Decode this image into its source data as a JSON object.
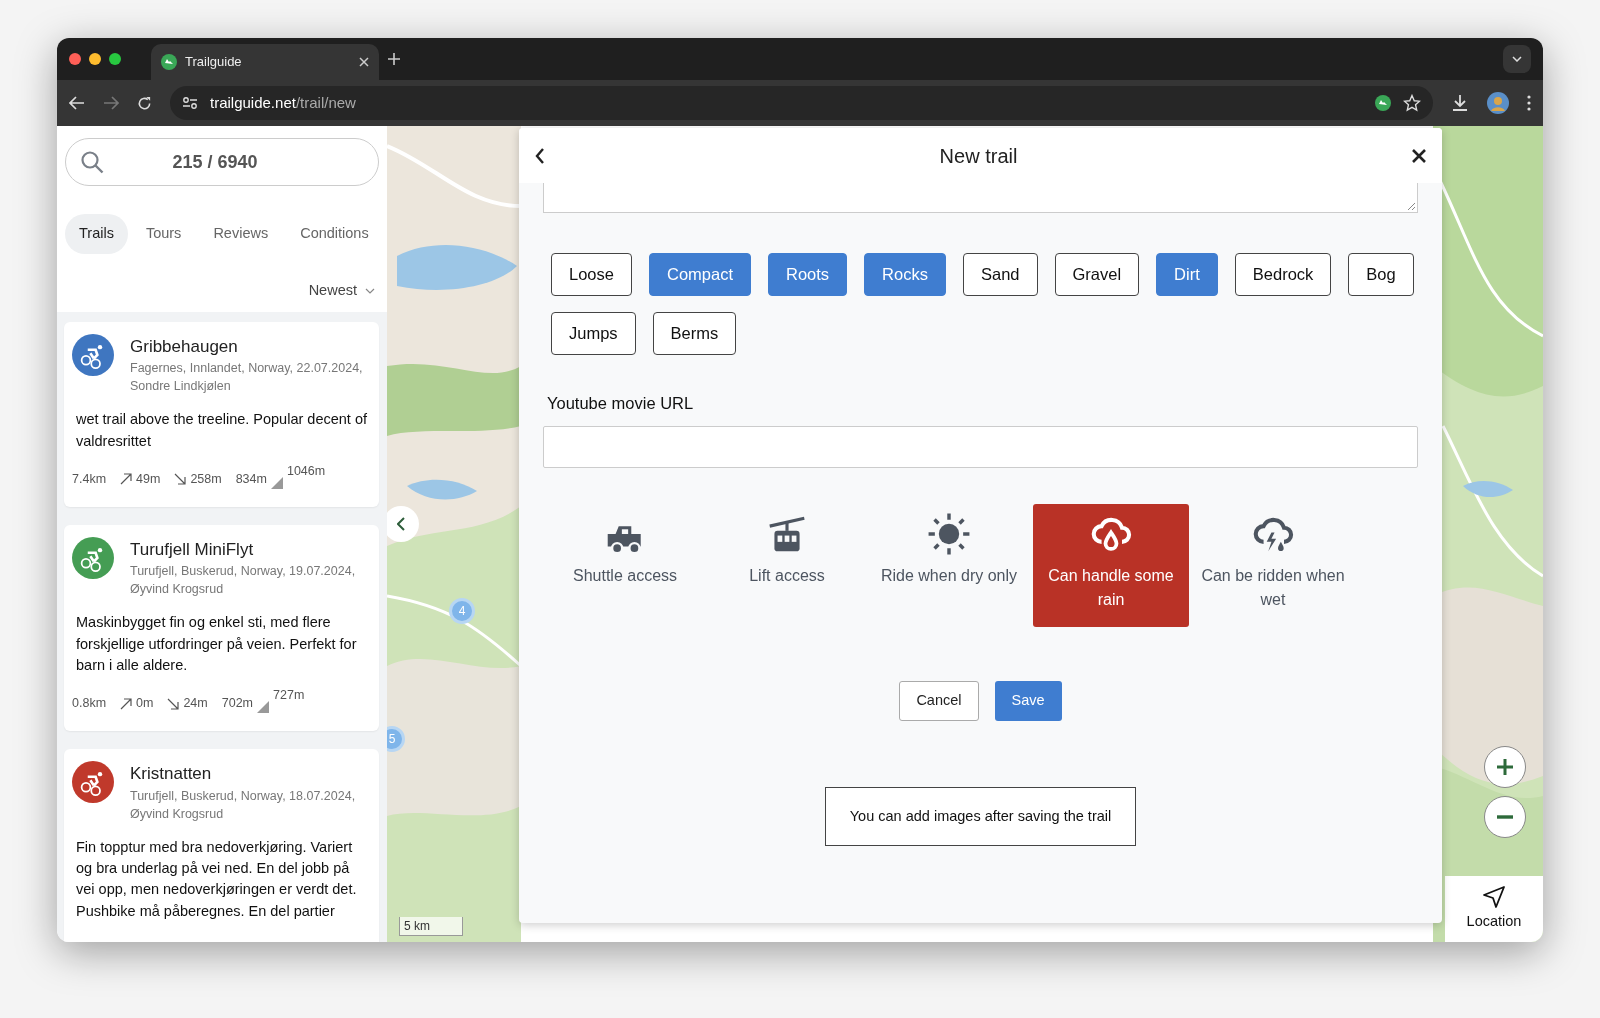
{
  "browser": {
    "tab_title": "Trailguide",
    "url_host": "trailguide.net",
    "url_path": "/trail/new"
  },
  "sidebar": {
    "search_count": "215 / 6940",
    "tabs": [
      {
        "label": "Trails",
        "selected": true
      },
      {
        "label": "Tours",
        "selected": false
      },
      {
        "label": "Reviews",
        "selected": false
      },
      {
        "label": "Conditions",
        "selected": false
      }
    ],
    "sort": "Newest",
    "trails": [
      {
        "name": "Gribbehaugen",
        "color": "#3f76c0",
        "place": "Fagernes, Innlandet, Norway, 22.07.2024,",
        "author": "Sondre Lindkjølen",
        "description": "wet trail above the treeline. Popular decent of valdresrittet",
        "distance": "7.4km",
        "ascent": "49m",
        "descent": "258m",
        "min_elevation": "834m",
        "max_elevation": "1046m"
      },
      {
        "name": "Turufjell MiniFlyt",
        "color": "#459d54",
        "place": "Turufjell, Buskerud, Norway, 19.07.2024,",
        "author": "Øyvind Krogsrud",
        "description": "Maskinbygget fin og enkel sti, med flere forskjellige utfordringer på veien. Perfekt for barn i alle aldere.",
        "distance": "0.8km",
        "ascent": "0m",
        "descent": "24m",
        "min_elevation": "702m",
        "max_elevation": "727m"
      },
      {
        "name": "Kristnatten",
        "color": "#c0392b",
        "place": "Turufjell, Buskerud, Norway, 18.07.2024,",
        "author": "Øyvind Krogsrud",
        "description": "Fin topptur med bra nedoverkjøring. Variert og bra underlag på vei ned. En del jobb på vei opp, men nedoverkjøringen er verdt det. Pushbike må påberegnes. En del partier"
      }
    ]
  },
  "map": {
    "markers": [
      "4",
      "5"
    ],
    "scale": "5 km",
    "location_label": "Location"
  },
  "modal": {
    "title": "New trail",
    "surfaces": [
      {
        "label": "Loose",
        "selected": false
      },
      {
        "label": "Compact",
        "selected": true
      },
      {
        "label": "Roots",
        "selected": true
      },
      {
        "label": "Rocks",
        "selected": true
      },
      {
        "label": "Sand",
        "selected": false
      },
      {
        "label": "Gravel",
        "selected": false
      },
      {
        "label": "Dirt",
        "selected": true
      },
      {
        "label": "Bedrock",
        "selected": false
      },
      {
        "label": "Bog",
        "selected": false
      },
      {
        "label": "Jumps",
        "selected": false
      },
      {
        "label": "Berms",
        "selected": false
      }
    ],
    "youtube_label": "Youtube movie URL",
    "conditions": [
      {
        "kind": "truck",
        "label": "Shuttle access",
        "selected": false
      },
      {
        "kind": "gondola",
        "label": "Lift access",
        "selected": false
      },
      {
        "kind": "sun",
        "label": "Ride when dry only",
        "selected": false
      },
      {
        "kind": "rain",
        "label": "Can handle some rain",
        "selected": true
      },
      {
        "kind": "storm",
        "label": "Can be ridden when wet",
        "selected": false
      }
    ],
    "cancel": "Cancel",
    "save": "Save",
    "note": "You can add images after saving the trail"
  }
}
